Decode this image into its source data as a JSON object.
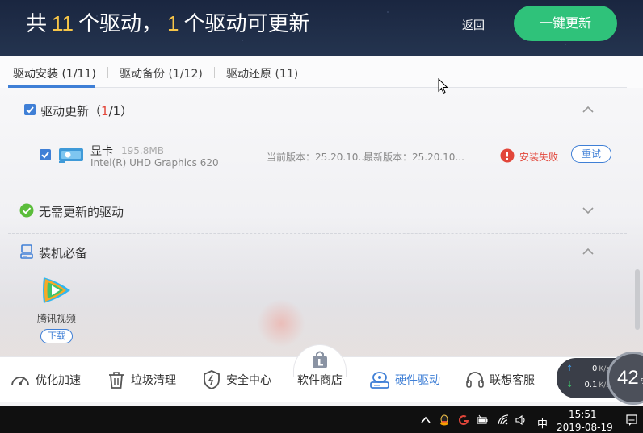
{
  "header": {
    "title_prefix": "共",
    "driver_count": "11",
    "title_mid": "个驱动，",
    "updatable_count": "1",
    "title_suffix": "个驱动可更新",
    "back_label": "返回",
    "update_all_label": "一键更新"
  },
  "tabs": [
    {
      "label": "驱动安装 (1/11)",
      "active": true
    },
    {
      "label": "驱动备份 (1/12)",
      "active": false
    },
    {
      "label": "驱动还原 (11)",
      "active": false
    }
  ],
  "sections": {
    "update": {
      "label": "驱动更新",
      "open_paren": "（",
      "count_highlight": "1",
      "count_rest": "/1）",
      "checked": true,
      "device": {
        "name": "显卡",
        "size": "195.8MB",
        "model": "Intel(R) UHD Graphics 620",
        "current_version": "当前版本：25.20.10...",
        "latest_version": "最新版本：25.20.10...",
        "status": "安装失败",
        "retry_label": "重试"
      }
    },
    "no_update": {
      "label": "无需更新的驱动"
    },
    "essentials": {
      "label": "装机必备",
      "app_name": "腾讯视频",
      "download_label": "下载"
    }
  },
  "bottom_nav": [
    {
      "label": "优化加速",
      "icon": "speedometer-icon"
    },
    {
      "label": "垃圾清理",
      "icon": "trash-icon"
    },
    {
      "label": "安全中心",
      "icon": "shield-icon"
    },
    {
      "label": "软件商店",
      "icon": "bag-icon"
    },
    {
      "label": "硬件驱动",
      "icon": "hardware-icon",
      "active": true
    },
    {
      "label": "联想客服",
      "icon": "headset-icon"
    }
  ],
  "speed": {
    "up_value": "0",
    "up_unit": "K/s",
    "down_value": "0.1",
    "down_unit": "K/s",
    "memory_percent": "42",
    "memory_unit": "%"
  },
  "taskbar": {
    "ime": "中",
    "time": "15:51",
    "date": "2019-08-19"
  },
  "colors": {
    "accent": "#3f7fd6",
    "update_button": "#2fc27a",
    "count_highlight": "#f6c548",
    "error": "#e2463a"
  }
}
